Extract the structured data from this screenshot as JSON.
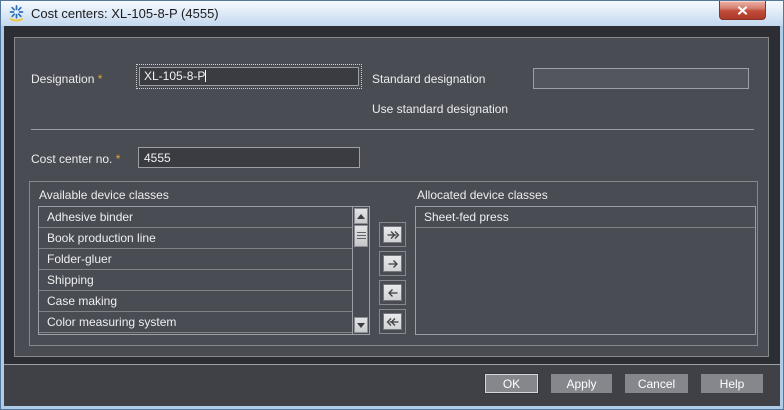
{
  "window": {
    "title": "Cost centers: XL-105-8-P (4555)",
    "icon": "prinect-star-icon"
  },
  "form": {
    "designation": {
      "label": "Designation",
      "required": "*",
      "value": "XL-105-8-P"
    },
    "standard_designation": {
      "label": "Standard designation",
      "value": ""
    },
    "use_standard_designation": "Use standard designation",
    "cost_center_no": {
      "label": "Cost center no.",
      "required": "*",
      "value": "4555"
    }
  },
  "device_classes": {
    "available": {
      "label": "Available device classes",
      "items": [
        "Adhesive binder",
        "Book production line",
        "Folder-gluer",
        "Shipping",
        "Case making",
        "Color measuring system"
      ]
    },
    "allocated": {
      "label": "Allocated device classes",
      "items": [
        "Sheet-fed press"
      ]
    },
    "transfer": {
      "move_all_right_icon": "double-right-arrow",
      "move_right_icon": "right-arrow",
      "move_left_icon": "left-arrow",
      "move_all_left_icon": "double-left-arrow"
    }
  },
  "footer": {
    "buttons": {
      "ok": "OK",
      "apply": "Apply",
      "cancel": "Cancel",
      "help": "Help"
    }
  },
  "colors": {
    "titlebar": "#dfebf8",
    "frame": "#aecbe8",
    "content_bg": "#2c2e34",
    "panel_bg": "#494c53",
    "field_bg": "#3a3c41",
    "required_marker": "#e2a33d",
    "button_bg": "#85878c",
    "close_button": "#c04c3a"
  }
}
